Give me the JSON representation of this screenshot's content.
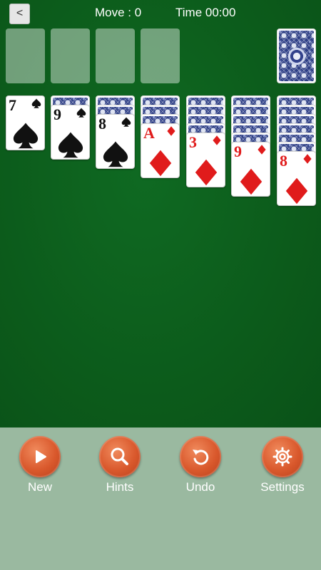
{
  "header": {
    "back_label": "<",
    "moves_text": "Move : 0",
    "time_text": "Time 00:00"
  },
  "foundations": {
    "count": 4
  },
  "stock": {
    "remaining": "face-down"
  },
  "tableau": [
    {
      "face_down": 0,
      "rank": "7",
      "suit": "spade",
      "color": "black"
    },
    {
      "face_down": 1,
      "rank": "9",
      "suit": "spade",
      "color": "black"
    },
    {
      "face_down": 2,
      "rank": "8",
      "suit": "spade",
      "color": "black"
    },
    {
      "face_down": 3,
      "rank": "A",
      "suit": "diamond",
      "color": "red"
    },
    {
      "face_down": 4,
      "rank": "3",
      "suit": "diamond",
      "color": "red"
    },
    {
      "face_down": 5,
      "rank": "9",
      "suit": "diamond",
      "color": "red"
    },
    {
      "face_down": 6,
      "rank": "8",
      "suit": "diamond",
      "color": "red"
    }
  ],
  "toolbar": {
    "new_label": "New",
    "hints_label": "Hints",
    "undo_label": "Undo",
    "settings_label": "Settings",
    "icons": {
      "new": "play-icon",
      "hints": "magnifier-icon",
      "undo": "undo-icon",
      "settings": "gear-icon"
    }
  },
  "colors": {
    "felt": "#0c5b1b",
    "toolbar": "#9ab9a0",
    "button": "#d9582c",
    "card_back": "#2e3f86",
    "red_suit": "#e01b1b"
  }
}
